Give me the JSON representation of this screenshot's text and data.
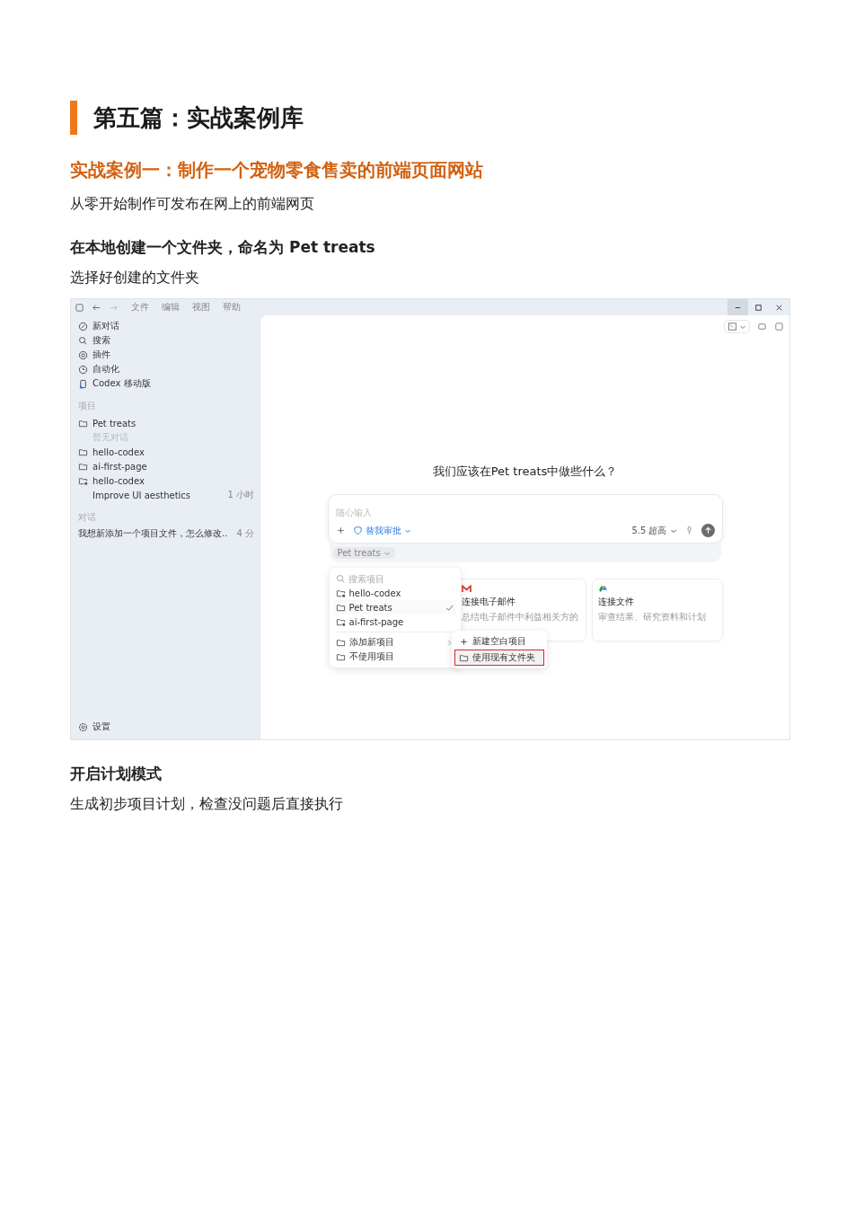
{
  "section_title": "第五篇：实战案例库",
  "case_title": "实战案例一：制作一个宠物零食售卖的前端页面网站",
  "intro": "从零开始制作可发布在网上的前端网页",
  "steps": [
    {
      "heading": "在本地创建一个文件夹，命名为 Pet treats",
      "text": "选择好创建的文件夹",
      "screenshot": {
        "menu_bar": [
          "文件",
          "编辑",
          "视图",
          "帮助"
        ],
        "nav": [
          {
            "label": "新对话",
            "kind": "compose"
          },
          {
            "label": "搜索",
            "kind": "search"
          },
          {
            "label": "插件",
            "kind": "plugin"
          },
          {
            "label": "自动化",
            "kind": "clock"
          },
          {
            "label": "Codex 移动版",
            "kind": "phone"
          }
        ],
        "projects_heading": "项目",
        "projects": [
          {
            "name": "Pet treats",
            "kind": "folder",
            "children": [
              {
                "label": "暂无对话",
                "kind": "empty"
              }
            ]
          },
          {
            "name": "hello-codex",
            "kind": "folder"
          },
          {
            "name": "ai-first-page",
            "kind": "folder"
          },
          {
            "name": "hello-codex",
            "kind": "folder-linked",
            "children": [
              {
                "label": "Improve UI aesthetics",
                "kind": "thread",
                "time": "1 小时"
              }
            ]
          }
        ],
        "conversations_heading": "对话",
        "conversations": [
          {
            "title": "我想新添加一个项目文件，怎么修改..",
            "time": "4 分"
          }
        ],
        "settings": "设置",
        "prompt": "我们应该在Pet treats中做些什么？",
        "composer": {
          "placeholder": "随心输入",
          "mode": "替我审批",
          "model": "5.5 超高"
        },
        "project_chip": "Pet treats",
        "dropdown": {
          "search_placeholder": "搜索项目",
          "items": [
            {
              "label": "hello-codex",
              "kind": "folder-linked",
              "selected": false
            },
            {
              "label": "Pet treats",
              "kind": "folder",
              "selected": true
            },
            {
              "label": "ai-first-page",
              "kind": "folder-linked",
              "selected": false
            }
          ],
          "actions": [
            {
              "label": "添加新项目",
              "kind": "submenu"
            },
            {
              "label": "不使用项目",
              "kind": "plain"
            }
          ],
          "submenu": [
            {
              "label": "新建空白项目",
              "kind": "plus",
              "highlighted": false
            },
            {
              "label": "使用现有文件夹",
              "kind": "folder",
              "highlighted": true
            }
          ]
        },
        "cards": [
          {
            "title": "连接电子邮件",
            "text": "总结电子邮件中利益相关方的",
            "kind": "mail"
          },
          {
            "title": "连接文件",
            "text": "审查结果、研究资料和计划",
            "kind": "drive"
          }
        ]
      }
    },
    {
      "heading": "开启计划模式",
      "text": "生成初步项目计划，检查没问题后直接执行"
    }
  ]
}
